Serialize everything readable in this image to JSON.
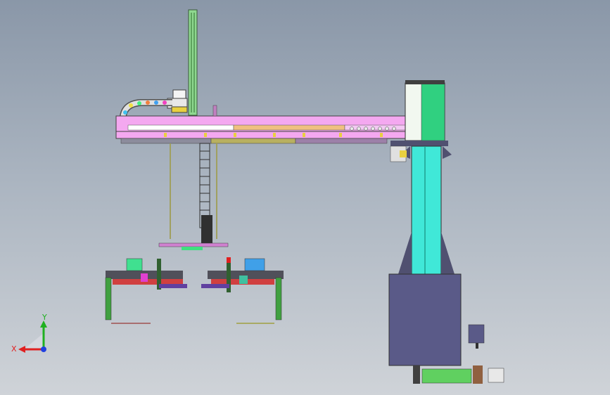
{
  "triad": {
    "x_label": "X",
    "y_label": "Y",
    "x_color": "#e02020",
    "y_color": "#20b020",
    "z_color": "#2040e0"
  },
  "colors": {
    "background_top": "#8a97a8",
    "background_bottom": "#cfd3d8",
    "arm_pink": "#f0a8f0",
    "arm_orange": "#f0c080",
    "column_cyan": "#40e8d8",
    "column_white": "#f4f8f4",
    "base_navy": "#5a5a88",
    "mast_green": "#90d890"
  }
}
